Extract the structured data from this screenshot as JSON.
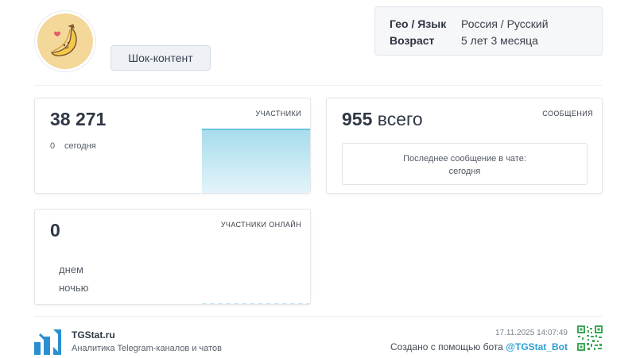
{
  "channel": {
    "category_label": "Шок-контент"
  },
  "info": {
    "geo_key": "Гео / Язык",
    "geo_value": "Россия / Русский",
    "age_key": "Возраст",
    "age_value": "5 лет 3 месяца"
  },
  "members": {
    "count": "38 271",
    "today_value": "0",
    "today_label": "сегодня",
    "label": "УЧАСТНИКИ"
  },
  "messages": {
    "count": "955",
    "unit": "всего",
    "label": "СООБЩЕНИЯ",
    "last_message_line1": "Последнее сообщение в чате:",
    "last_message_line2": "сегодня"
  },
  "online": {
    "count": "0",
    "label": "УЧАСТНИКИ ОНЛАЙН",
    "day_label": "днем",
    "night_label": "ночью"
  },
  "footer": {
    "brand": "TGStat.ru",
    "tagline": "Аналитика Telegram-каналов и чатов",
    "timestamp": "17.11.2025 14:07:49",
    "created_text": "Создано с помощью бота",
    "bot_handle": "@TGStat_Bot"
  },
  "colors": {
    "accent": "#2b9fd6",
    "chart_fill": "#a7ddec",
    "avatar_bg": "#f3d89a"
  },
  "icons": {
    "avatar": "banana-icon",
    "logo": "tgstat-logo-icon",
    "qr": "qr-code-icon"
  }
}
